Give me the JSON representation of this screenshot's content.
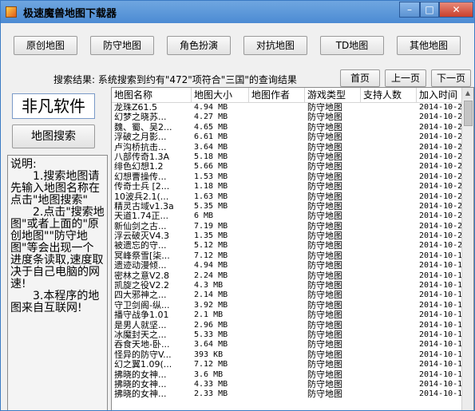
{
  "window": {
    "title": "极速魔兽地图下载器",
    "controls": {
      "minimize": "–",
      "maximize": "□",
      "close": "✕"
    }
  },
  "tabs": [
    {
      "label": "原创地图"
    },
    {
      "label": "防守地图"
    },
    {
      "label": "角色扮演"
    },
    {
      "label": "对抗地图"
    },
    {
      "label": "TD地图"
    },
    {
      "label": "其他地图"
    }
  ],
  "search_result": "搜索结果: 系统搜索到约有\"472\"项符合\"三国\"的查询结果",
  "nav": {
    "first": "首页",
    "prev": "上一页",
    "next": "下一页"
  },
  "brand": "非凡软件",
  "map_search_button": "地图搜索",
  "help": {
    "heading": "说明:",
    "p1": "1.搜索地图请先输入地图名称在点击\"地图搜索\"",
    "p2": "2.点击\"搜索地图\"或者上面的\"原创地图\"\"防守地图\"等会出现一个进度条读取,速度取决于自己电脑的网速!",
    "p3": "3.本程序的地图来自互联网!"
  },
  "table": {
    "columns": [
      "地图名称",
      "地图大小",
      "地图作者",
      "游戏类型",
      "支持人数",
      "加入时间"
    ],
    "rows": [
      [
        "龙珠Z61.5",
        "4.94 MB",
        "",
        "防守地图",
        "",
        "2014-10-2"
      ],
      [
        "幻梦之晓苏...",
        "4.27 MB",
        "",
        "防守地图",
        "",
        "2014-10-2"
      ],
      [
        "魏、蜀、吴2...",
        "4.65 MB",
        "",
        "防守地图",
        "",
        "2014-10-2"
      ],
      [
        "浮破之月影...",
        "6.61 MB",
        "",
        "防守地图",
        "",
        "2014-10-2"
      ],
      [
        "卢沟桥抗击...",
        "3.64 MB",
        "",
        "防守地图",
        "",
        "2014-10-2"
      ],
      [
        "八部传奇1.3A",
        "5.18 MB",
        "",
        "防守地图",
        "",
        "2014-10-2"
      ],
      [
        "绯色幻想1.2",
        "5.66 MB",
        "",
        "防守地图",
        "",
        "2014-10-2"
      ],
      [
        "幻想曹操传...",
        "1.53 MB",
        "",
        "防守地图",
        "",
        "2014-10-2"
      ],
      [
        "传奇士兵 [2...",
        "1.18 MB",
        "",
        "防守地图",
        "",
        "2014-10-2"
      ],
      [
        "10波兵2.1(...",
        "1.63 MB",
        "",
        "防守地图",
        "",
        "2014-10-2"
      ],
      [
        "精灵古域v1.3a",
        "5.35 MB",
        "",
        "防守地图",
        "",
        "2014-10-2"
      ],
      [
        "天道1.74正...",
        "6 MB",
        "",
        "防守地图",
        "",
        "2014-10-2"
      ],
      [
        "新仙剑之古...",
        "7.19 MB",
        "",
        "防守地图",
        "",
        "2014-10-2"
      ],
      [
        "浮云破灭V4.3",
        "1.35 MB",
        "",
        "防守地图",
        "",
        "2014-10-2"
      ],
      [
        "被遗忘的守...",
        "5.12 MB",
        "",
        "防守地图",
        "",
        "2014-10-2"
      ],
      [
        "冥峰祭雪[柒...",
        "7.12 MB",
        "",
        "防守地图",
        "",
        "2014-10-1"
      ],
      [
        "遗迹动漫倾...",
        "4.94 MB",
        "",
        "防守地图",
        "",
        "2014-10-1"
      ],
      [
        "密林之意V2.8",
        "2.24 MB",
        "",
        "防守地图",
        "",
        "2014-10-1"
      ],
      [
        "凯旋之役V2.2",
        "4.3 MB",
        "",
        "防守地图",
        "",
        "2014-10-1"
      ],
      [
        "四大邪神之...",
        "2.14 MB",
        "",
        "防守地图",
        "",
        "2014-10-1"
      ],
      [
        "守卫剑阁-纵...",
        "3.92 MB",
        "",
        "防守地图",
        "",
        "2014-10-1"
      ],
      [
        "播守战争1.01",
        "2.1 MB",
        "",
        "防守地图",
        "",
        "2014-10-1"
      ],
      [
        "是男人就坚...",
        "2.96 MB",
        "",
        "防守地图",
        "",
        "2014-10-1"
      ],
      [
        "冰魔封天之...",
        "5.33 MB",
        "",
        "防守地图",
        "",
        "2014-10-1"
      ],
      [
        "吞食天地-卧...",
        "3.64 MB",
        "",
        "防守地图",
        "",
        "2014-10-1"
      ],
      [
        "怪异的防守V...",
        "393 KB",
        "",
        "防守地图",
        "",
        "2014-10-1"
      ],
      [
        "幻之翼1.09(...",
        "7.12 MB",
        "",
        "防守地图",
        "",
        "2014-10-1"
      ],
      [
        "拂晓的女神...",
        "3.6 MB",
        "",
        "防守地图",
        "",
        "2014-10-1"
      ],
      [
        "拂晓的女神...",
        "4.33 MB",
        "",
        "防守地图",
        "",
        "2014-10-1"
      ],
      [
        "拂晓的女神...",
        "2.33 MB",
        "",
        "防守地图",
        "",
        "2014-10-1"
      ]
    ]
  },
  "scrollbar": {
    "up": "▲"
  }
}
